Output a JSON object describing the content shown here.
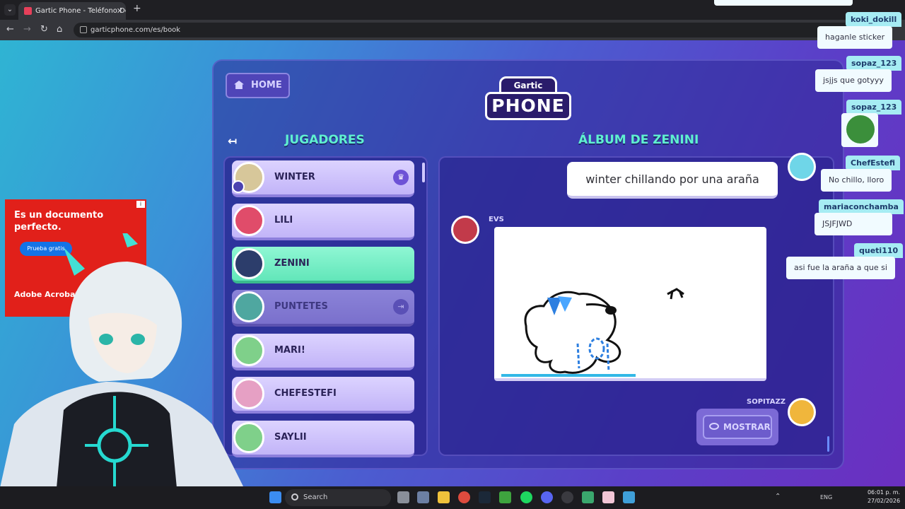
{
  "browser": {
    "tab_title": "Gartic Phone - Teléfono Descon",
    "tab_close": "✕",
    "new_tab": "+",
    "url": "garticphone.com/es/book",
    "nav_back": "←",
    "nav_forward": "→",
    "nav_reload": "↻",
    "nav_home": "⌂"
  },
  "game": {
    "home_label": "HOME",
    "logo_top": "Gartic",
    "logo_bottom": "PHONE",
    "players_heading": "JUGADORES",
    "album_heading": "ÁLBUM DE ZENINI",
    "exit_glyph": "↤",
    "players": [
      {
        "name": "WINTER",
        "state": "host"
      },
      {
        "name": "LILI",
        "state": "normal"
      },
      {
        "name": "ZENINI",
        "state": "active"
      },
      {
        "name": "PUNTETES",
        "state": "away"
      },
      {
        "name": "MARI!",
        "state": "normal"
      },
      {
        "name": "CHEFESTEFI",
        "state": "normal"
      },
      {
        "name": "SAYLII",
        "state": "normal"
      }
    ],
    "crown_glyph": "♛",
    "leave_glyph": "⇥",
    "album": {
      "caption": "winter chillando por una araña",
      "drawing_author": "EVS",
      "next_author": "SOPITAZZ",
      "show_button": "MOSTRAR"
    }
  },
  "chat": [
    {
      "user": "koki_dokill",
      "message": "haganle sticker"
    },
    {
      "user": "sopaz_123",
      "message": "jsjjs que gotyyy"
    },
    {
      "user": "sopaz_123",
      "message": ""
    },
    {
      "user": "ChefEstefi",
      "message": "No chillo, lloro"
    },
    {
      "user": "mariaconchamba",
      "message": "JSJFJWD"
    },
    {
      "user": "queti110",
      "message": "asi fue la araña a que si"
    }
  ],
  "ad": {
    "headline": "Es un documento perfecto.",
    "cta": "Prueba gratis",
    "brand": "Adobe Acrobat Pro",
    "info": "i"
  },
  "taskbar": {
    "search_placeholder": "Search",
    "language": "ENG",
    "time": "06:01 p. m.",
    "date": "27/02/2026"
  },
  "colors": {
    "accent_heading": "#5ff0d0",
    "player_active": "#62e6b9",
    "player_normal": "#c2b4f8",
    "chat_name_bg": "#a6ecf3"
  }
}
